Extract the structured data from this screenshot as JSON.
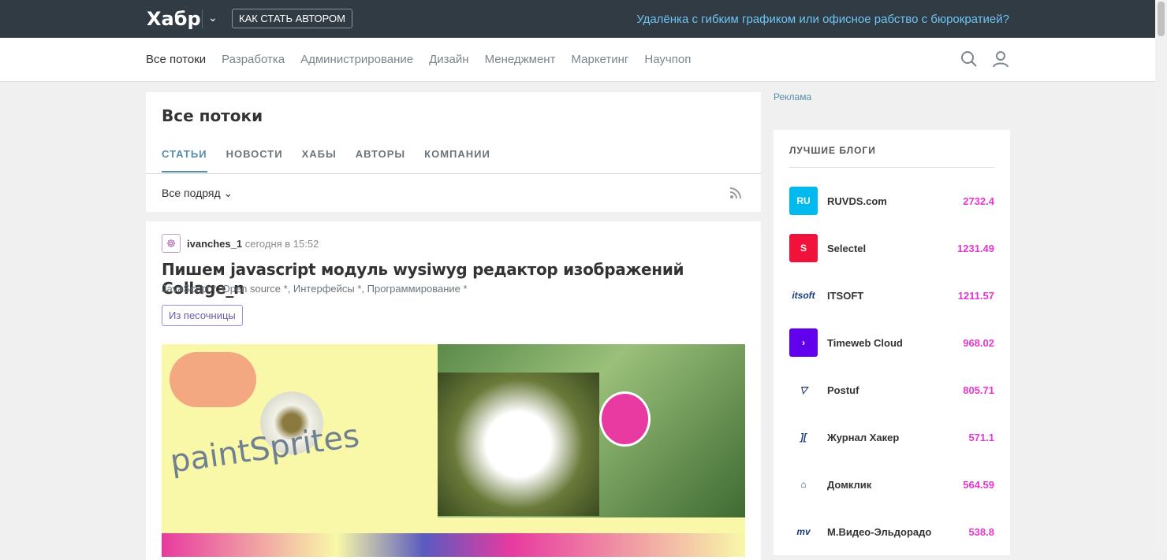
{
  "header": {
    "logo": "Хабр",
    "author_button": "КАК СТАТЬ АВТОРОМ",
    "promo": "Удалёнка с гибким графиком или офисное рабство с бюрократией?"
  },
  "nav": [
    "Все потоки",
    "Разработка",
    "Администрирование",
    "Дизайн",
    "Менеджмент",
    "Маркетинг",
    "Научпоп"
  ],
  "feed": {
    "title": "Все потоки",
    "tabs": [
      "СТАТЬИ",
      "НОВОСТИ",
      "ХАБЫ",
      "АВТОРЫ",
      "КОМПАНИИ"
    ],
    "filter": "Все подряд"
  },
  "post": {
    "author": "ivanches_1",
    "time": "сегодня в 15:52",
    "title": "Пишем javascript модуль wysiwyg редактор изображений Collage_n",
    "hubs": "JavaScript *, Open source *, Интерфейсы *, Программирование *",
    "badge": "Из песочницы"
  },
  "sidebar": {
    "ad": "Реклама",
    "title": "ЛУЧШИЕ БЛОГИ",
    "blogs": [
      {
        "name": "RUVDS.com",
        "score": "2732.4",
        "logo": "RU",
        "color": "#00b9ee"
      },
      {
        "name": "Selectel",
        "score": "1231.49",
        "logo": "S",
        "color": "#f0123a"
      },
      {
        "name": "ITSOFT",
        "score": "1211.57",
        "logo": "itsoft",
        "color": "#ffffff"
      },
      {
        "name": "Timeweb Cloud",
        "score": "968.02",
        "logo": "›",
        "color": "#6200ee"
      },
      {
        "name": "Postuf",
        "score": "805.71",
        "logo": "▽",
        "color": "#ffffff"
      },
      {
        "name": "Журнал Хакер",
        "score": "571.1",
        "logo": "][",
        "color": "#ffffff"
      },
      {
        "name": "Домклик",
        "score": "564.59",
        "logo": "⌂",
        "color": "#ffffff"
      },
      {
        "name": "М.Видео-Эльдорадо",
        "score": "538.8",
        "logo": "mv",
        "color": "#ffffff"
      }
    ]
  }
}
